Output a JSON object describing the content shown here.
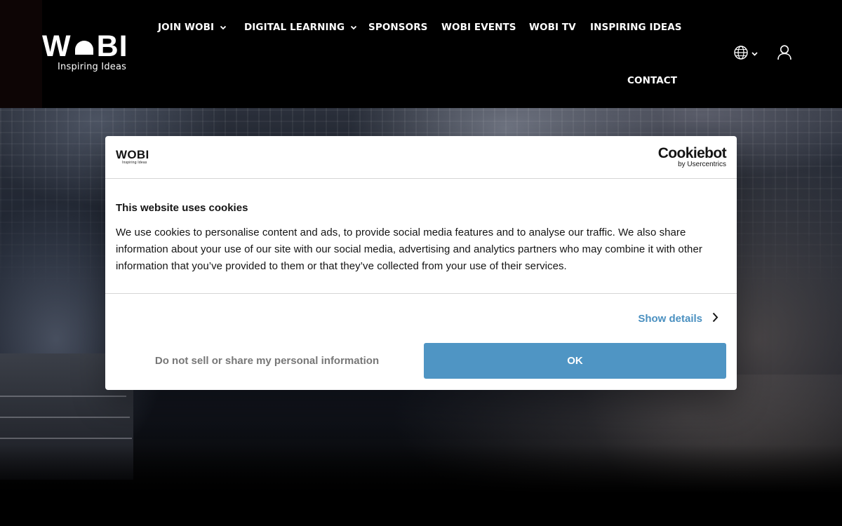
{
  "header": {
    "logo": {
      "name": "WOBI",
      "tagline": "Inspiring Ideas"
    },
    "nav": [
      {
        "label": "JOIN WOBI",
        "has_dropdown": true
      },
      {
        "label": "DIGITAL LEARNING",
        "has_dropdown": true
      },
      {
        "label": "SPONSORS",
        "has_dropdown": false
      },
      {
        "label": "WOBI EVENTS",
        "has_dropdown": false
      },
      {
        "label": "WOBI TV",
        "has_dropdown": false
      },
      {
        "label": "INSPIRING IDEAS",
        "has_dropdown": false
      },
      {
        "label": "CONTACT",
        "has_dropdown": false
      }
    ],
    "icons": {
      "language": "globe-icon",
      "language_dropdown": "chevron-down-icon",
      "account": "user-icon"
    }
  },
  "hero": {
    "image": "conference-hall-audience-photo"
  },
  "cookie_dialog": {
    "logo": {
      "name": "WOBI",
      "tagline": "Inspiring Ideas"
    },
    "provider": {
      "name": "Cookiebot",
      "by": "by Usercentrics"
    },
    "title": "This website uses cookies",
    "text": "We use cookies to personalise content and ads, to provide social media features and to analyse our traffic. We also share information about your use of our site with our social media, advertising and analytics partners who may combine it with other information that you’ve provided to them or that they’ve collected from your use of their services.",
    "show_details": "Show details",
    "deny_label": "Do not sell or share my personal information",
    "ok_label": "OK"
  },
  "colors": {
    "header_bg": "#000000",
    "nav_text": "#ffffff",
    "dialog_bg": "#ffffff",
    "link": "#4a90c0",
    "ok_button": "#4f95c4",
    "deny_text": "#777777"
  }
}
